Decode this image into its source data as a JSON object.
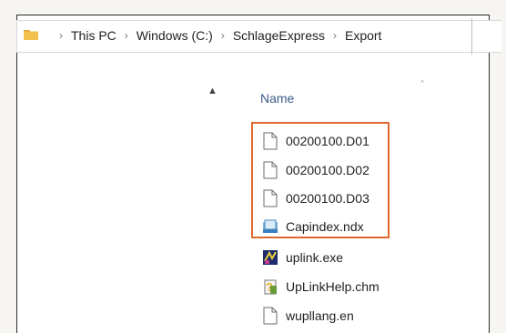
{
  "breadcrumb": {
    "items": [
      "This PC",
      "Windows (C:)",
      "SchlageExpress",
      "Export"
    ]
  },
  "column": {
    "name_header": "Name"
  },
  "files": [
    {
      "name": "00200100.D01",
      "icon": "blank-file-icon"
    },
    {
      "name": "00200100.D02",
      "icon": "blank-file-icon"
    },
    {
      "name": "00200100.D03",
      "icon": "blank-file-icon"
    },
    {
      "name": "Capindex.ndx",
      "icon": "ndx-file-icon"
    },
    {
      "name": "uplink.exe",
      "icon": "exe-app-icon"
    },
    {
      "name": "UpLinkHelp.chm",
      "icon": "chm-help-icon"
    },
    {
      "name": "wupllang.en",
      "icon": "blank-file-icon"
    }
  ],
  "colors": {
    "highlight": "#e0682c",
    "folder": "#f2c14e",
    "header_text": "#3d5b8c"
  }
}
